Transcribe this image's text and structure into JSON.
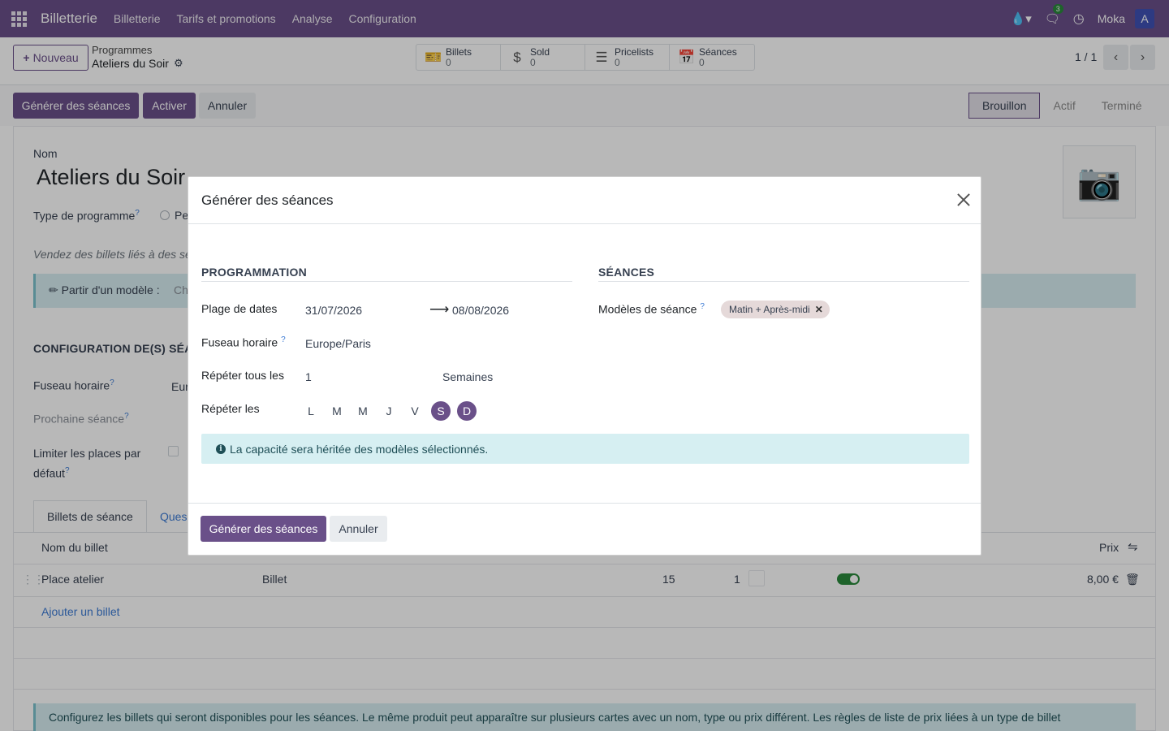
{
  "navbar": {
    "brand": "Billetterie",
    "menu": [
      "Billetterie",
      "Tarifs et promotions",
      "Analyse",
      "Configuration"
    ],
    "messages_count": "3",
    "company": "Moka",
    "avatar_letter": "A"
  },
  "control": {
    "new_label": "Nouveau",
    "breadcrumb_parent": "Programmes",
    "breadcrumb_current": "Ateliers du Soir",
    "smart_buttons": [
      {
        "label": "Billets",
        "value": "0",
        "icon": "ticket-icon"
      },
      {
        "label": "Sold",
        "value": "0",
        "icon": "dollar-icon"
      },
      {
        "label": "Pricelists",
        "value": "0",
        "icon": "list-icon"
      },
      {
        "label": "Séances",
        "value": "0",
        "icon": "calendar-icon"
      }
    ],
    "pager": "1 / 1"
  },
  "actions": {
    "generate": "Générer des séances",
    "activate": "Activer",
    "cancel": "Annuler",
    "status": [
      "Brouillon",
      "Actif",
      "Terminé"
    ],
    "status_active": "Brouillon"
  },
  "form": {
    "name_label": "Nom",
    "name_value": "Ateliers du Soir",
    "type_label": "Type de programme",
    "type_option_partial": "Pe",
    "description_partial": "Vendez des billets liés à des se",
    "template_label": "Partir d'un modèle :",
    "template_placeholder_partial": "Ch",
    "config_title_partial": "CONFIGURATION DE(S) SÉA",
    "timezone_label": "Fuseau horaire",
    "timezone_value_partial": "Eur",
    "next_session_label": "Prochaine séance",
    "limit_label_line1": "Limiter les places par",
    "limit_label_line2": "défaut",
    "tab_tickets": "Billets de séance",
    "tab_questions_partial": "Ques",
    "col_ticket_name": "Nom du billet",
    "col_price": "Prix",
    "row": {
      "name": "Place atelier",
      "type": "Billet",
      "qty": "15",
      "qty2": "1",
      "price": "8,00 €"
    },
    "add_ticket": "Ajouter un billet",
    "bottom_info": "Configurez les billets qui seront disponibles pour les séances. Le même produit peut apparaître sur plusieurs cartes avec un nom, type ou prix différent. Les règles de liste de prix liées à un type de billet"
  },
  "modal": {
    "title": "Générer des séances",
    "section_scheduling": "PROGRAMMATION",
    "section_sessions": "SÉANCES",
    "date_range_label": "Plage de dates",
    "date_start": "31/07/2026",
    "date_end": "08/08/2026",
    "timezone_label": "Fuseau horaire",
    "timezone_value": "Europe/Paris",
    "repeat_every_label": "Répéter tous les",
    "repeat_every_value": "1",
    "repeat_unit": "Semaines",
    "repeat_on_label": "Répéter les",
    "days": [
      {
        "letter": "L",
        "selected": false
      },
      {
        "letter": "M",
        "selected": false
      },
      {
        "letter": "M",
        "selected": false
      },
      {
        "letter": "J",
        "selected": false
      },
      {
        "letter": "V",
        "selected": false
      },
      {
        "letter": "S",
        "selected": true
      },
      {
        "letter": "D",
        "selected": true
      }
    ],
    "templates_label": "Modèles de séance",
    "template_tag": "Matin + Après-midi",
    "info_message": "La capacité sera héritée des modèles sélectionnés.",
    "generate_button": "Générer des séances",
    "cancel_button": "Annuler"
  },
  "colors": {
    "brand": "#6a5089",
    "info_bg": "#d6eff2",
    "toggle_on": "#2a8a3c"
  }
}
